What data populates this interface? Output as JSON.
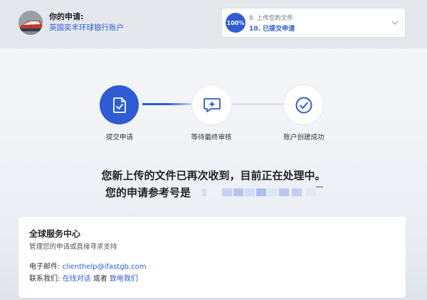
{
  "header": {
    "title": "你的申请:",
    "subtitle": "英国奕丰环球银行账户",
    "progress": {
      "percent_label": "100%",
      "previous_step": "9. 上传您的文件",
      "current_step": "10. 已提交申请"
    }
  },
  "stepper": {
    "steps": [
      {
        "label": "提交申请",
        "icon": "document-check-icon",
        "state": "active"
      },
      {
        "label": "等待最终审核",
        "icon": "chat-sparkle-icon",
        "state": "pending"
      },
      {
        "label": "账户创建成功",
        "icon": "check-circle-icon",
        "state": "pending"
      }
    ]
  },
  "message": {
    "line1": "您新上传的文件已再次收到，目前正在处理中。",
    "line2": "您的申请参考号是"
  },
  "service": {
    "title": "全球服务中心",
    "subtitle": "管理您的申请或直接寻求支持",
    "email_label": "电子邮件: ",
    "email": "clienthelp@ifastgb.com",
    "contact_label": "联系我们: ",
    "chat_link": "在线对话",
    "or": " 或者 ",
    "call_link": "致电我们"
  },
  "colors": {
    "accent": "#2f5bd3",
    "link": "#2a5bd7"
  }
}
